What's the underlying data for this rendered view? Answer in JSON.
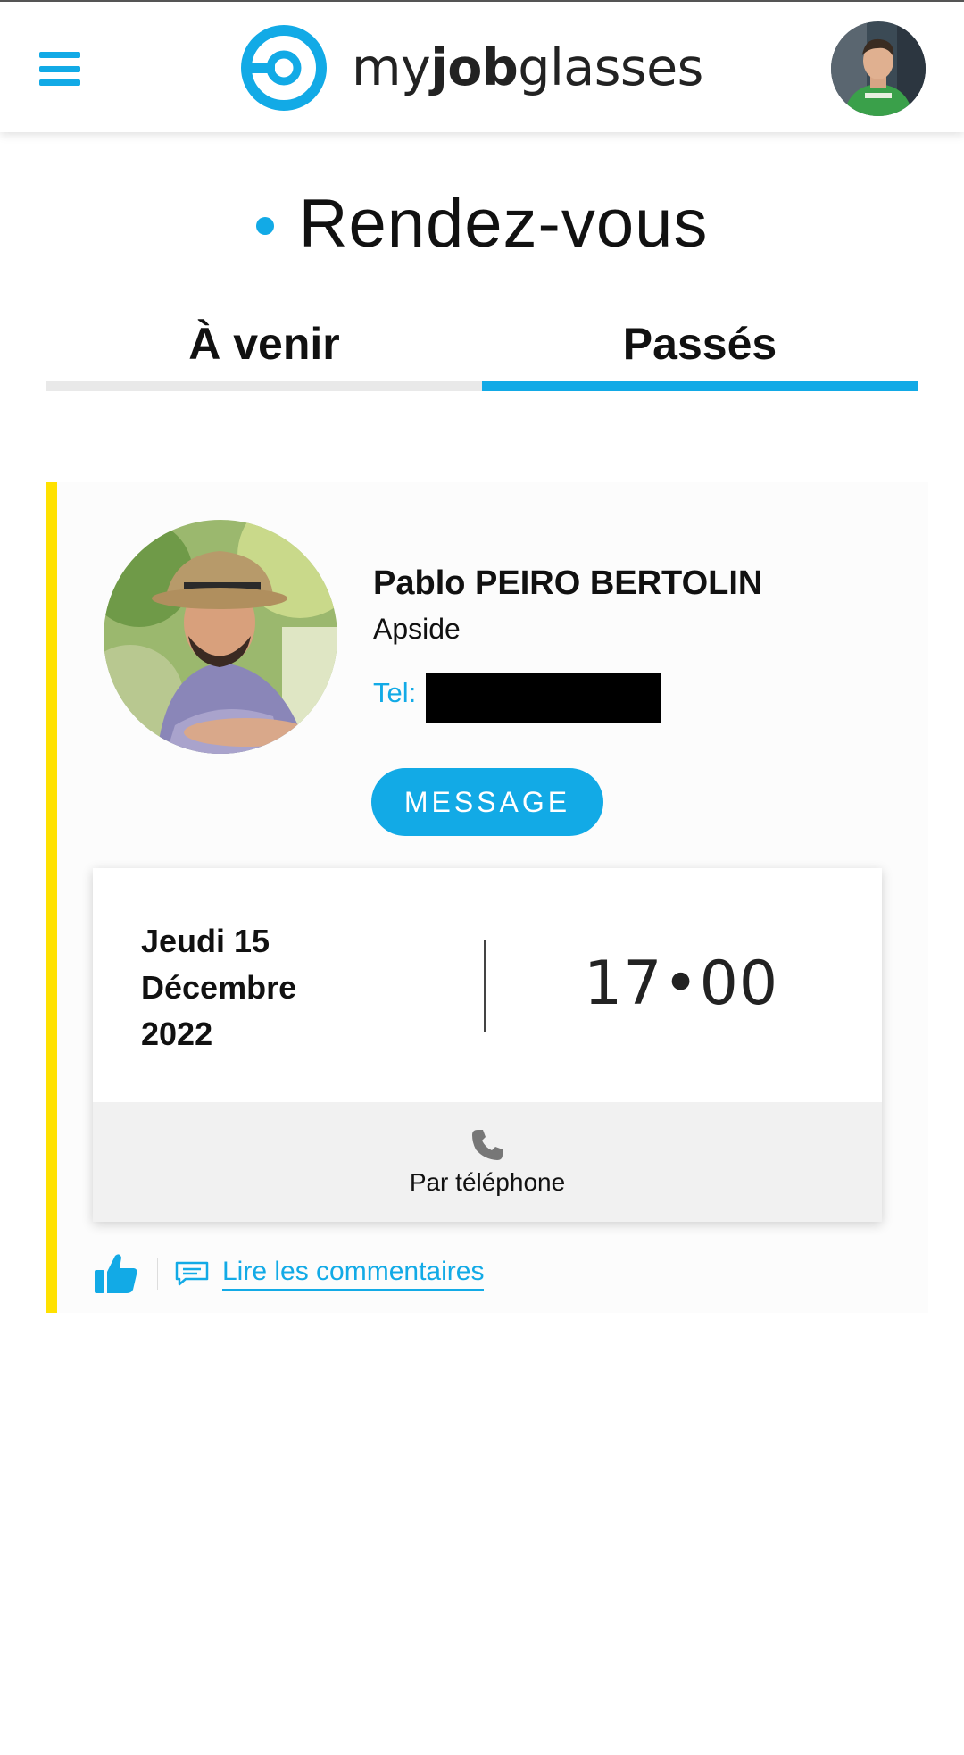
{
  "header": {
    "brand": {
      "part1": "my",
      "part2": "job",
      "part3": "glasses"
    },
    "menu_icon": "hamburger-menu-icon",
    "avatar_icon": "user-avatar"
  },
  "page": {
    "title": "Rendez-vous"
  },
  "tabs": [
    {
      "label": "À venir",
      "active": false
    },
    {
      "label": "Passés",
      "active": true
    }
  ],
  "appointment": {
    "name": "Pablo PEIRO BERTOLIN",
    "company": "Apside",
    "tel_label": "Tel:",
    "message_button": "MESSAGE",
    "date_lines": [
      "Jeudi 15",
      "Décembre",
      "2022"
    ],
    "time": "17•00",
    "mode_icon": "phone-icon",
    "mode": "Par téléphone",
    "like_icon": "thumbs-up-icon",
    "comments_icon": "comment-icon",
    "comments_link": "Lire les commentaires"
  },
  "colors": {
    "accent": "#12aae6",
    "card_border": "#ffe100",
    "tab_inactive": "#e9e9e9"
  }
}
